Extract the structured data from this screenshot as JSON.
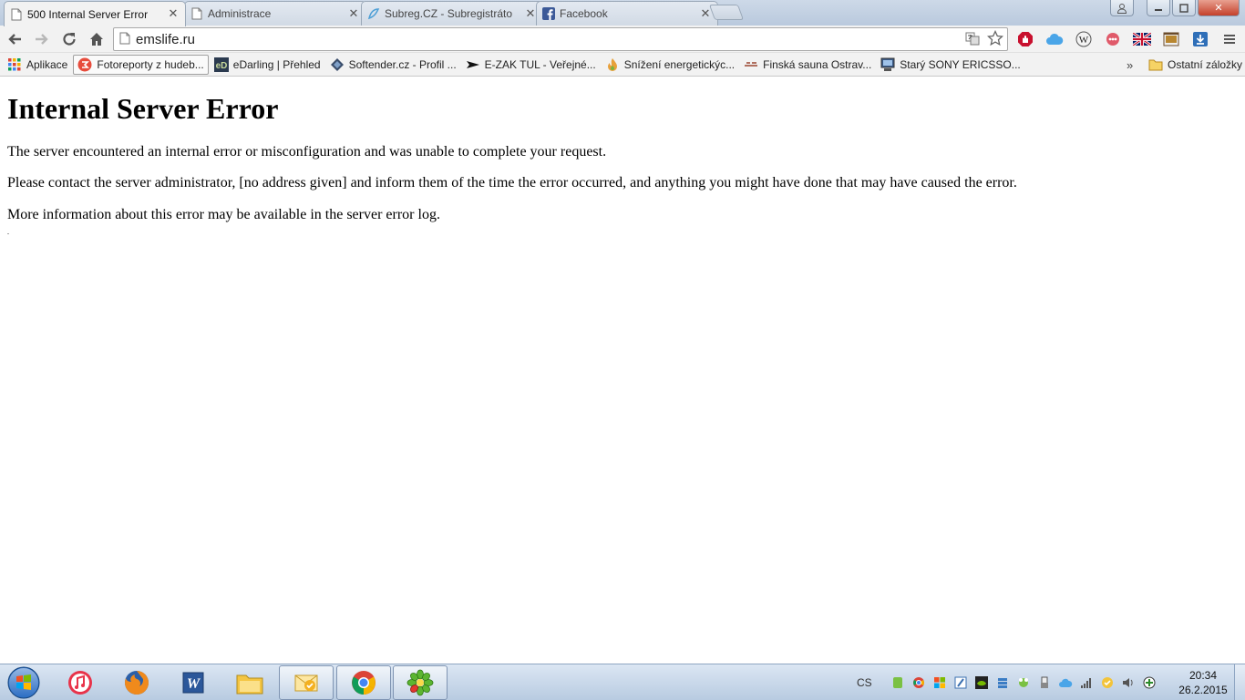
{
  "tabs": [
    {
      "title": "500 Internal Server Error",
      "active": true,
      "icon": "page-icon"
    },
    {
      "title": "Administrace",
      "active": false,
      "icon": "page-icon"
    },
    {
      "title": "Subreg.CZ - Subregistráto",
      "active": false,
      "icon": "subreg-icon"
    },
    {
      "title": "Facebook",
      "active": false,
      "icon": "facebook-icon"
    }
  ],
  "toolbar": {
    "url": "emslife.ru"
  },
  "bookmarks": {
    "items": [
      {
        "label": "Aplikace",
        "icon": "apps-grid-icon"
      },
      {
        "label": "Fotoreporty z hudeb...",
        "icon": "fotoreporty-icon"
      },
      {
        "label": "eDarling | Přehled",
        "icon": "edarling-icon"
      },
      {
        "label": "Softender.cz - Profil ...",
        "icon": "softender-icon"
      },
      {
        "label": "E-ZAK TUL - Veřejné...",
        "icon": "ezak-icon"
      },
      {
        "label": "Snížení energetickýc...",
        "icon": "flame-icon"
      },
      {
        "label": "Finská sauna Ostrav...",
        "icon": "sauna-icon"
      },
      {
        "label": "Starý SONY ERICSSO...",
        "icon": "monitor-icon"
      }
    ],
    "more": "»",
    "other": "Ostatní záložky"
  },
  "page": {
    "heading": "Internal Server Error",
    "p1": "The server encountered an internal error or misconfiguration and was unable to complete your request.",
    "p2": "Please contact the server administrator, [no address given] and inform them of the time the error occurred, and anything you might have done that may have caused the error.",
    "p3": "More information about this error may be available in the server error log.",
    "dot": "."
  },
  "taskbar": {
    "apps": [
      "itunes-icon",
      "firefox-icon",
      "word-icon",
      "explorer-icon",
      "outlook-icon",
      "chrome-icon",
      "icq-icon"
    ],
    "lang": "CS",
    "time": "20:34",
    "date": "26.2.2015"
  },
  "colors": {
    "facebook": "#3b5998",
    "close_red": "#c4402a",
    "chrome_red": "#db4437",
    "chrome_green": "#0f9d58",
    "chrome_yellow": "#f4b400",
    "chrome_blue": "#4285f4"
  }
}
